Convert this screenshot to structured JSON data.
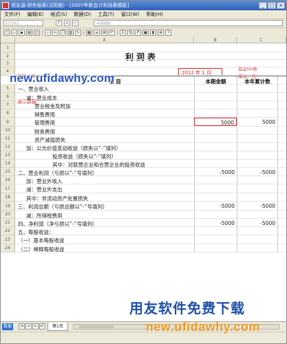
{
  "window": {
    "title": "用友通-财务报表(试用版) - [2007年新会计利润表模板]"
  },
  "menu": [
    "文件(F)",
    "编辑(E)",
    "格式(S)",
    "数据(D)",
    "工具(T)",
    "窗口(W)",
    "帮助(H)"
  ],
  "cellbar": {
    "ref": "E2101",
    "formula": "=5000"
  },
  "toolbar": {
    "format_btn": "Σ",
    "chart_btn": "P"
  },
  "sheet": {
    "columns": [
      "A",
      "B",
      "C"
    ],
    "title": "利润表",
    "form_no": "会企02表",
    "unit": "单位：元",
    "period": "2012 年 1 月",
    "annotation_left": "某某公司",
    "annotation_mid": "演示数据",
    "header": {
      "item": "项          目",
      "current": "本期金额",
      "ytd": "本年累计数"
    },
    "rows": [
      {
        "num": "1",
        "item": "",
        "indent": 0,
        "current": "",
        "ytd": ""
      },
      {
        "num": "2",
        "item": "",
        "indent": 0,
        "current": "",
        "ytd": ""
      },
      {
        "num": "3",
        "item": "",
        "indent": 0,
        "current": "",
        "ytd": ""
      },
      {
        "num": "4",
        "item": "",
        "indent": 0,
        "current": "",
        "ytd": ""
      },
      {
        "num": "5",
        "item": "一、营业收入",
        "indent": 0,
        "current": "",
        "ytd": ""
      },
      {
        "num": "6",
        "item": "减：营业成本",
        "indent": 1,
        "current": "",
        "ytd": ""
      },
      {
        "num": "7",
        "item": "营业税金及附加",
        "indent": 2,
        "current": "",
        "ytd": ""
      },
      {
        "num": "8",
        "item": "销售费用",
        "indent": 2,
        "current": "",
        "ytd": ""
      },
      {
        "num": "9",
        "item": "管理费用",
        "indent": 2,
        "current": "5000",
        "ytd": "5000"
      },
      {
        "num": "10",
        "item": "财务费用",
        "indent": 2,
        "current": "",
        "ytd": ""
      },
      {
        "num": "11",
        "item": "资产减值损失",
        "indent": 2,
        "current": "",
        "ytd": ""
      },
      {
        "num": "12",
        "item": "加：公允价值变动收益（损失以“-”填列）",
        "indent": 1,
        "current": "",
        "ytd": ""
      },
      {
        "num": "13",
        "item": "投资收益（损失以“-”填列）",
        "indent": 3,
        "current": "",
        "ytd": ""
      },
      {
        "num": "14",
        "item": "其中：对联营企业和合营企业的投资收益",
        "indent": 3,
        "current": "",
        "ytd": ""
      },
      {
        "num": "15",
        "item": "二、营业利润（亏损以“-”号填列）",
        "indent": 0,
        "current": "-5000",
        "ytd": "-5000"
      },
      {
        "num": "16",
        "item": "加：营业外收入",
        "indent": 1,
        "current": "",
        "ytd": ""
      },
      {
        "num": "17",
        "item": "减：营业外支出",
        "indent": 1,
        "current": "",
        "ytd": ""
      },
      {
        "num": "18",
        "item": "其中：非流动资产处置损失",
        "indent": 1,
        "current": "",
        "ytd": ""
      },
      {
        "num": "19",
        "item": "三、利润总额（亏损总额以“-”号填列）",
        "indent": 0,
        "current": "-5000",
        "ytd": "-5000"
      },
      {
        "num": "20",
        "item": "减：所得税费用",
        "indent": 1,
        "current": "",
        "ytd": ""
      },
      {
        "num": "21",
        "item": "四、净利润（净亏损以“-”号填列）",
        "indent": 0,
        "current": "-5000",
        "ytd": "-5000"
      },
      {
        "num": "22",
        "item": "五、每股收益：",
        "indent": 0,
        "current": "",
        "ytd": ""
      },
      {
        "num": "23",
        "item": "（一）基本每股收益",
        "indent": 0,
        "current": "",
        "ytd": ""
      },
      {
        "num": "24",
        "item": "（二）稀释每股收益",
        "indent": 0,
        "current": "",
        "ytd": ""
      }
    ]
  },
  "tabs": {
    "mode": "数据",
    "sheet_tab": "第1页"
  },
  "watermark": {
    "top_url": "new.ufidawhy.com",
    "bottom_cn": "用友软件免费下载",
    "bottom_url": "new.ufidawhy.com"
  }
}
